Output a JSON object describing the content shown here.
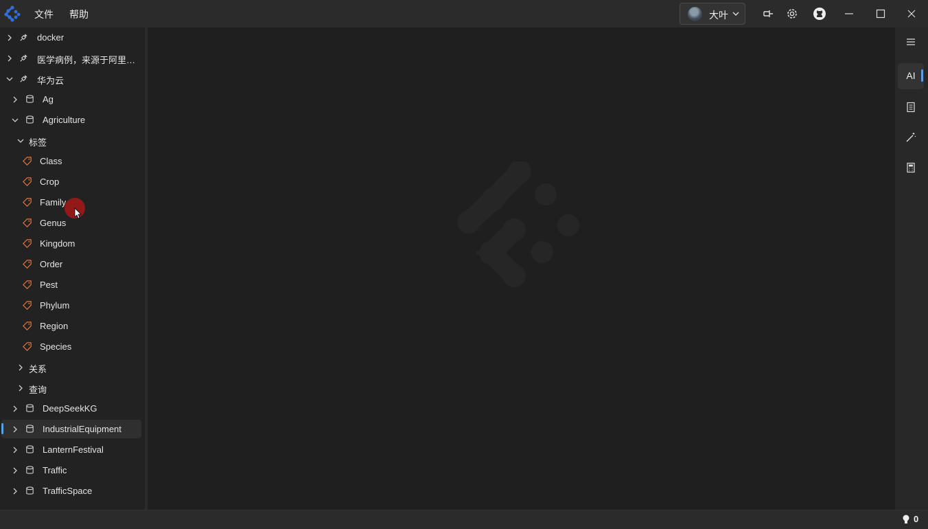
{
  "menu": {
    "file": "文件",
    "help": "帮助"
  },
  "user": {
    "name": "大叶"
  },
  "colors": {
    "accent": "#5aa0e6",
    "tag": "#e8743b",
    "logo": "#2f6fd6"
  },
  "icons": {
    "pin": "pin-icon",
    "settings": "gear-icon",
    "github": "github-icon",
    "minimize": "minimize-icon",
    "maximize": "maximize-icon",
    "close": "close-icon",
    "connection": "plug-icon",
    "database": "database-icon",
    "tag": "tag-icon"
  },
  "tree": {
    "connections": [
      {
        "label": "docker",
        "expanded": false
      },
      {
        "label": "医学病例，来源于阿里云...",
        "expanded": false
      },
      {
        "label": "华为云",
        "expanded": true
      }
    ],
    "databases_top": [
      {
        "label": "Ag",
        "expanded": false
      },
      {
        "label": "Agriculture",
        "expanded": true
      }
    ],
    "groups": {
      "tags": "标签",
      "relations": "关系",
      "queries": "查询"
    },
    "tags": [
      "Class",
      "Crop",
      "Family",
      "Genus",
      "Kingdom",
      "Order",
      "Pest",
      "Phylum",
      "Region",
      "Species"
    ],
    "databases_bottom": [
      {
        "label": "DeepSeekKG",
        "selected": false
      },
      {
        "label": "IndustrialEquipment",
        "selected": true
      },
      {
        "label": "LanternFestival",
        "selected": false
      },
      {
        "label": "Traffic",
        "selected": false
      },
      {
        "label": "TrafficSpace",
        "selected": false
      }
    ]
  },
  "rail": {
    "ai_label": "AI",
    "items": [
      "menu-icon",
      "ai-tab",
      "notes-icon",
      "magic-wand-icon",
      "calculator-icon"
    ]
  },
  "status": {
    "notification_count": "0"
  }
}
